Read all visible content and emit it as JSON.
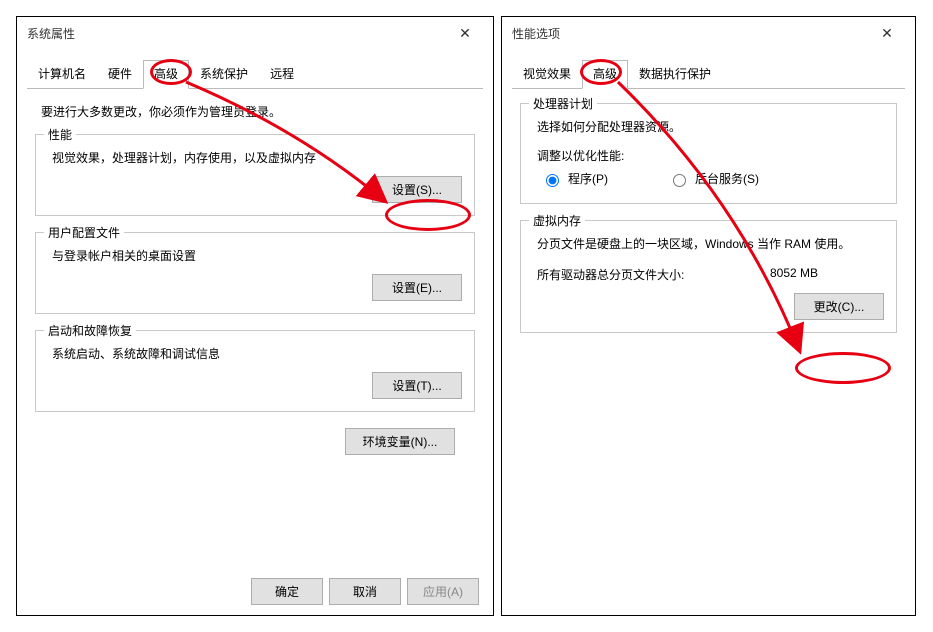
{
  "left": {
    "title": "系统属性",
    "tabs": [
      "计算机名",
      "硬件",
      "高级",
      "系统保护",
      "远程"
    ],
    "notice": "要进行大多数更改，你必须作为管理员登录。",
    "performance": {
      "title": "性能",
      "desc": "视觉效果，处理器计划，内存使用，以及虚拟内存",
      "button": "设置(S)..."
    },
    "userprofile": {
      "title": "用户配置文件",
      "desc": "与登录帐户相关的桌面设置",
      "button": "设置(E)..."
    },
    "startup": {
      "title": "启动和故障恢复",
      "desc": "系统启动、系统故障和调试信息",
      "button": "设置(T)..."
    },
    "envvars_button": "环境变量(N)...",
    "ok": "确定",
    "cancel": "取消",
    "apply": "应用(A)"
  },
  "right": {
    "title": "性能选项",
    "tabs": [
      "视觉效果",
      "高级",
      "数据执行保护"
    ],
    "processor": {
      "title": "处理器计划",
      "desc": "选择如何分配处理器资源。",
      "adjust_label": "调整以优化性能:",
      "radio_programs": "程序(P)",
      "radio_background": "后台服务(S)"
    },
    "virtualmem": {
      "title": "虚拟内存",
      "desc": "分页文件是硬盘上的一块区域，Windows 当作 RAM 使用。",
      "total_label": "所有驱动器总分页文件大小:",
      "total_value": "8052 MB",
      "button": "更改(C)..."
    }
  }
}
